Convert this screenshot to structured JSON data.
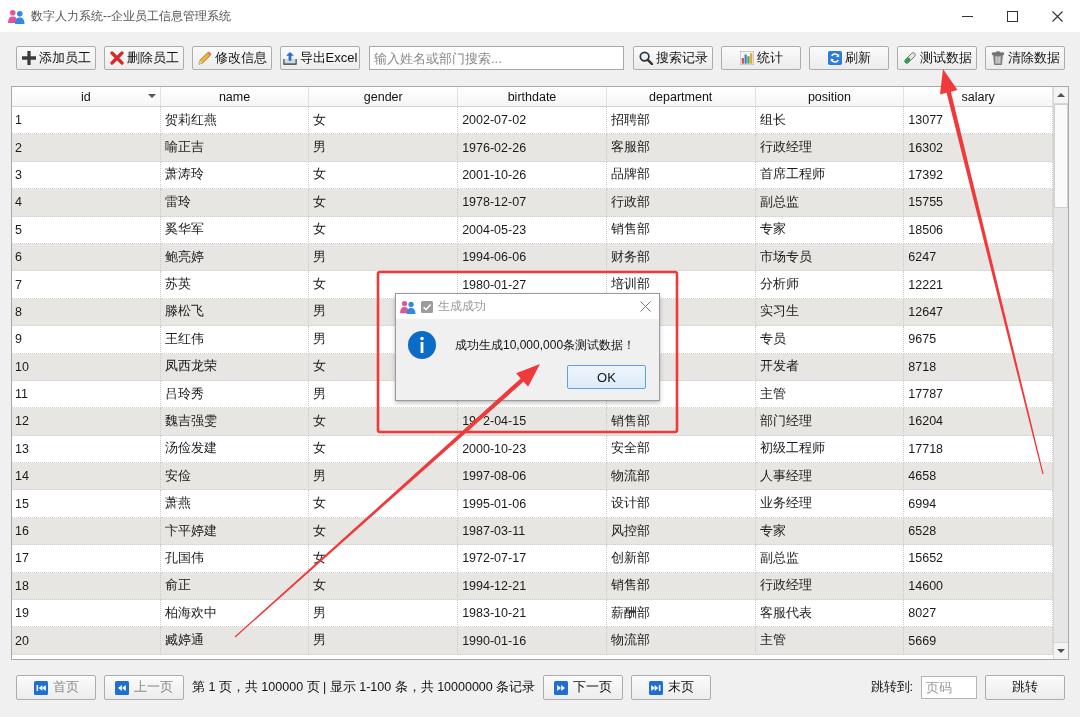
{
  "window": {
    "title": "数字人力系统--企业员工信息管理系统"
  },
  "toolbar": [
    {
      "kind": "button",
      "label": "添加员工"
    },
    {
      "kind": "button",
      "label": "删除员工"
    },
    {
      "kind": "button",
      "label": "修改信息"
    },
    {
      "kind": "button",
      "label": "导出Excel"
    },
    {
      "kind": "search",
      "placeholder": "输入姓名或部门搜索..."
    },
    {
      "kind": "button",
      "label": "搜索记录"
    },
    {
      "kind": "button",
      "label": "统计"
    },
    {
      "kind": "button",
      "label": "刷新"
    },
    {
      "kind": "button",
      "label": "测试数据"
    },
    {
      "kind": "button",
      "label": "清除数据"
    }
  ],
  "table": {
    "columns": [
      {
        "label": "id",
        "sorted": true
      },
      {
        "label": "name",
        "sorted": false
      },
      {
        "label": "gender",
        "sorted": false
      },
      {
        "label": "birthdate",
        "sorted": false
      },
      {
        "label": "department",
        "sorted": false
      },
      {
        "label": "position",
        "sorted": false
      },
      {
        "label": "salary",
        "sorted": false
      }
    ],
    "rows": [
      {
        "id": "1",
        "name": "贺莉红燕",
        "gender": "女",
        "birthdate": "2002-07-02",
        "department": "招聘部",
        "position": "组长",
        "salary": "13077"
      },
      {
        "id": "2",
        "name": "喻正吉",
        "gender": "男",
        "birthdate": "1976-02-26",
        "department": "客服部",
        "position": "行政经理",
        "salary": "16302"
      },
      {
        "id": "3",
        "name": "萧涛玲",
        "gender": "女",
        "birthdate": "2001-10-26",
        "department": "品牌部",
        "position": "首席工程师",
        "salary": "17392"
      },
      {
        "id": "4",
        "name": "雷玲",
        "gender": "女",
        "birthdate": "1978-12-07",
        "department": "行政部",
        "position": "副总监",
        "salary": "15755"
      },
      {
        "id": "5",
        "name": "奚华军",
        "gender": "女",
        "birthdate": "2004-05-23",
        "department": "销售部",
        "position": "专家",
        "salary": "18506"
      },
      {
        "id": "6",
        "name": "鲍亮婷",
        "gender": "男",
        "birthdate": "1994-06-06",
        "department": "财务部",
        "position": "市场专员",
        "salary": "6247"
      },
      {
        "id": "7",
        "name": "苏英",
        "gender": "女",
        "birthdate": "1980-01-27",
        "department": "培训部",
        "position": "分析师",
        "salary": "12221"
      },
      {
        "id": "8",
        "name": "滕松飞",
        "gender": "男",
        "position": "实习生",
        "salary": "12647"
      },
      {
        "id": "9",
        "name": "王红伟",
        "gender": "男",
        "position": "专员",
        "salary": "9675"
      },
      {
        "id": "10",
        "name": "凤西龙荣",
        "gender": "女",
        "position": "开发者",
        "salary": "8718"
      },
      {
        "id": "11",
        "name": "吕玲秀",
        "gender": "男",
        "position": "主管",
        "salary": "17787"
      },
      {
        "id": "12",
        "name": "魏吉强雯",
        "gender": "女",
        "birthdate": [
          "19",
          "2-04-15"
        ],
        "department": "销售部",
        "position": "部门经理",
        "salary": "16204"
      },
      {
        "id": "13",
        "name": "汤俭发建",
        "gender": "女",
        "birthdate": "2000-10-23",
        "department": "安全部",
        "position": "初级工程师",
        "salary": "17718"
      },
      {
        "id": "14",
        "name": "安俭",
        "gender": "男",
        "birthdate": "1997-08-06",
        "department": "物流部",
        "position": "人事经理",
        "salary": "4658"
      },
      {
        "id": "15",
        "name": "萧燕",
        "gender": "女",
        "birthdate": "1995-01-06",
        "department": "设计部",
        "position": "业务经理",
        "salary": "6994"
      },
      {
        "id": "16",
        "name": "卞平婷建",
        "gender": "女",
        "birthdate": "1987-03-11",
        "department": "风控部",
        "position": "专家",
        "salary": "6528"
      },
      {
        "id": "17",
        "name": "孔国伟",
        "gender": "女",
        "birthdate": "1972-07-17",
        "department": "创新部",
        "position": "副总监",
        "salary": "15652"
      },
      {
        "id": "18",
        "name": "俞正",
        "gender": "女",
        "birthdate": "1994-12-21",
        "department": "销售部",
        "position": "行政经理",
        "salary": "14600"
      },
      {
        "id": "19",
        "name": "柏海欢中",
        "gender": "男",
        "birthdate": "1983-10-21",
        "department": "薪酬部",
        "position": "客服代表",
        "salary": "8027"
      },
      {
        "id": "20",
        "name": "臧婷通",
        "gender": "男",
        "birthdate": "1990-01-16",
        "department": "物流部",
        "position": "主管",
        "salary": "5669"
      }
    ]
  },
  "dialog": {
    "title": "生成成功",
    "message": "成功生成10,000,000条测试数据！",
    "button": "OK"
  },
  "pagination": {
    "items": [
      {
        "kind": "button",
        "label": "首页",
        "disabled": true
      },
      {
        "kind": "button",
        "label": "上一页",
        "disabled": true
      },
      {
        "kind": "text",
        "text": "第 1 页，共 100000 页 | 显示 1-100 条，共 10000000 条记录"
      },
      {
        "kind": "button",
        "label": "下一页",
        "disabled": false
      },
      {
        "kind": "button",
        "label": "末页",
        "disabled": false
      }
    ],
    "jump_label": "跳转到:",
    "jump_field": {
      "placeholder": "页码"
    },
    "jump_button": "跳转"
  }
}
